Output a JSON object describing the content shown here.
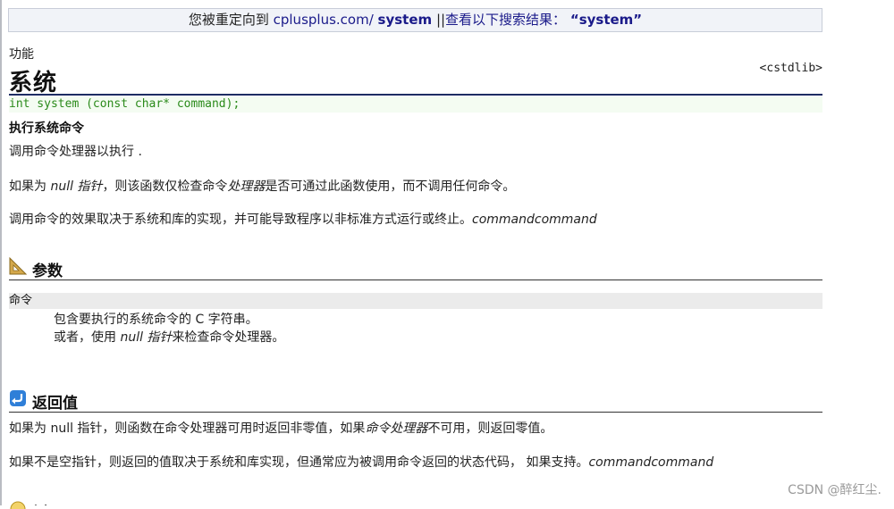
{
  "redirect": {
    "prefix": "您被重定向到",
    "link_text": "cplusplus.com/",
    "link_bold": "system",
    "separator": "||",
    "search_text": "查看以下搜索结果：",
    "query": "“system”"
  },
  "header": {
    "category": "功能",
    "title": "系统",
    "library": "<cstdlib>"
  },
  "prototype": "int system (const char* command);",
  "summary": {
    "subtitle": "执行系统命令",
    "line1": "调用命令处理器以执行 .",
    "line2_a": "如果为 ",
    "line2_b": "null 指针",
    "line2_c": "，则该函数仅检查命令",
    "line2_d": "处理器",
    "line2_e": "是否可通过此函数使用，而不调用任何命令。",
    "line3_a": "调用命令的效果取决于系统和库的实现，并可能导致程序以非标准方式运行或终止。",
    "line3_b": "commandcommand"
  },
  "parameters": {
    "heading": "参数",
    "name": "命令",
    "desc1": "包含要执行的系统命令的 C 字符串。",
    "desc2_a": "或者，使用 ",
    "desc2_b": "null 指针",
    "desc2_c": "来检查命令处理器。"
  },
  "return_value": {
    "heading": "返回值",
    "line1_a": "如果为 null 指针，则函数在命令处理器可用时返回非零值，如果",
    "line1_b": "命令处理器",
    "line1_c": "不可用，则返回零值。",
    "line2_a": "如果不是空指针，则返回的值取决于系统和库实现，但通常应为被调用命令返回的状态代码， 如果支持。",
    "line2_b": "commandcommand"
  },
  "next_section_heading": "例",
  "watermark": "CSDN @醉红尘."
}
